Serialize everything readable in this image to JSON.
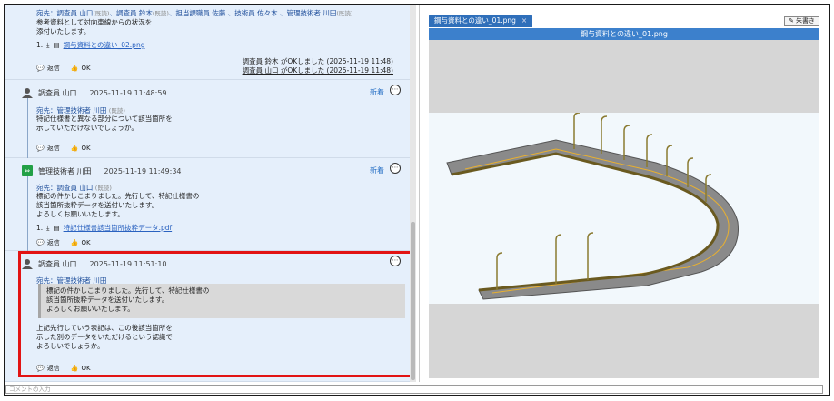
{
  "thread": {
    "msg1": {
      "to_label": "宛先：調査員 山口",
      "to_rest": "、調査員 鈴木",
      "to_rest2": "、担当課職員 佐藤 、技術員 佐々木 、管理技術者 川田",
      "read": "(既読)",
      "body": "参考資料として対向車線からの状況を\n添付いたします。",
      "attach_index": "1.",
      "attach_name": "鋼与資料との違い_02.png",
      "reply": "返信",
      "ok": "OK",
      "ok_line1": "調査員 鈴木 がOKしました (2025-11-19 11:48)",
      "ok_line2": "調査員 山口 がOKしました (2025-11-19 11:48)"
    },
    "msg2": {
      "author": "調査員 山口",
      "time": "2025-11-19 11:48:59",
      "new": "新着",
      "to": "宛先：管理技術者 川田",
      "read": "(既読)",
      "body": "特記仕様書と異なる部分について該当箇所を\n示していただけないでしょうか。",
      "reply": "返信",
      "ok": "OK"
    },
    "msg3": {
      "author": "管理技術者 川田",
      "time": "2025-11-19 11:49:34",
      "new": "新着",
      "to": "宛先：調査員 山口",
      "read": "(既読)",
      "body": "標記の件かしこまりました。先行して、特記仕様書の\n該当箇所抜粋データを送付いたします。\nよろしくお願いいたします。",
      "attach_index": "1.",
      "attach_name": "特記仕様書該当箇所抜粋データ.pdf",
      "reply": "返信",
      "ok": "OK"
    },
    "msg4": {
      "author": "調査員 山口",
      "time": "2025-11-19 11:51:10",
      "to": "宛先：管理技術者 川田",
      "quote": "標記の件かしこまりました。先行して、特記仕様書の\n該当箇所抜粋データを送付いたします。\nよろしくお願いいたします。",
      "body": "上記先行していう表記は、この後該当箇所を\n示した別のデータをいただけるという認識で\nよろしいでしょうか。",
      "reply": "返信",
      "ok": "OK"
    }
  },
  "viewer": {
    "tab_label": "鋼与資料との違い_01.png",
    "tab_close": "×",
    "annotate_button": "朱書き",
    "image_title": "鋼与資料との違い_01.png"
  },
  "comment_placeholder": "コメントの入力",
  "colors": {
    "highlight": "#e21313",
    "accent": "#2f6fba",
    "thread_bg": "#e5effb"
  }
}
